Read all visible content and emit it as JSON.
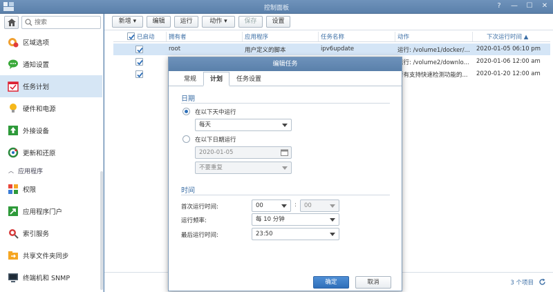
{
  "window": {
    "title": "控制面板",
    "help_glyph": "?",
    "minimize_glyph": "—",
    "maximize_glyph": "☐",
    "close_glyph": "✕"
  },
  "sidebar": {
    "search_placeholder": "搜索",
    "items": [
      {
        "label": "区域选项",
        "icon": "globe-clock-icon"
      },
      {
        "label": "通知设置",
        "icon": "chat-bubble-icon"
      },
      {
        "label": "任务计划",
        "icon": "calendar-check-icon",
        "active": true
      },
      {
        "label": "硬件和电源",
        "icon": "lightbulb-icon"
      },
      {
        "label": "外接设备",
        "icon": "upload-arrow-icon"
      },
      {
        "label": "更新和还原",
        "icon": "refresh-arrows-icon"
      }
    ],
    "section_label": "应用程序",
    "app_items": [
      {
        "label": "权限",
        "icon": "blocks-icon"
      },
      {
        "label": "应用程序门户",
        "icon": "portal-arrow-icon"
      },
      {
        "label": "索引服务",
        "icon": "magnifier-icon"
      },
      {
        "label": "共享文件夹同步",
        "icon": "folder-sync-icon"
      },
      {
        "label": "终端机和 SNMP",
        "icon": "terminal-icon"
      }
    ]
  },
  "toolbar": {
    "create": "新增",
    "edit": "编辑",
    "run": "运行",
    "action": "动作",
    "save": "保存",
    "settings": "设置"
  },
  "grid": {
    "headers": {
      "enabled": "已启动",
      "owner": "拥有者",
      "app": "应用程序",
      "task": "任务名称",
      "action": "动作",
      "next_run": "下次运行时间 ▲"
    },
    "rows": [
      {
        "enabled": true,
        "owner": "root",
        "app": "用户定义的脚本",
        "task": "ipv6update",
        "action": "运行: /volume1/docker/...",
        "next_run": "2020-01-05 06:10 pm"
      },
      {
        "enabled": true,
        "owner": "",
        "app": "",
        "task": "",
        "action": "运行: /volume2/downlo...",
        "next_run": "2020-01-06 12:00 am"
      },
      {
        "enabled": true,
        "owner": "",
        "app": "",
        "task": "",
        "action": "所有支持快速检测功能的...",
        "next_run": "2020-01-20 12:00 am"
      }
    ],
    "count_text": "3 个项目"
  },
  "dialog": {
    "title": "编辑任务",
    "tabs": [
      "常规",
      "计划",
      "任务设置"
    ],
    "active_tab": 1,
    "date_section": "日期",
    "radio_daily_label": "在以下天中运行",
    "daily_value": "每天",
    "radio_date_label": "在以下日期运行",
    "date_value": "2020-01-05",
    "repeat_value": "不要重复",
    "time_section": "时间",
    "first_run_label": "首次运行时间:",
    "first_run_hour": "00",
    "first_run_minute": "00",
    "frequency_label": "运行频率:",
    "frequency_value": "每 10 分钟",
    "last_run_label": "最后运行时间:",
    "last_run_value": "23:50",
    "ok": "确定",
    "cancel": "取消"
  },
  "colors": {
    "accent": "#3b6ea5",
    "titlebar": "#5d87b3",
    "selected_row": "#d4e5f6",
    "primary_button": "#2f6fb9"
  }
}
